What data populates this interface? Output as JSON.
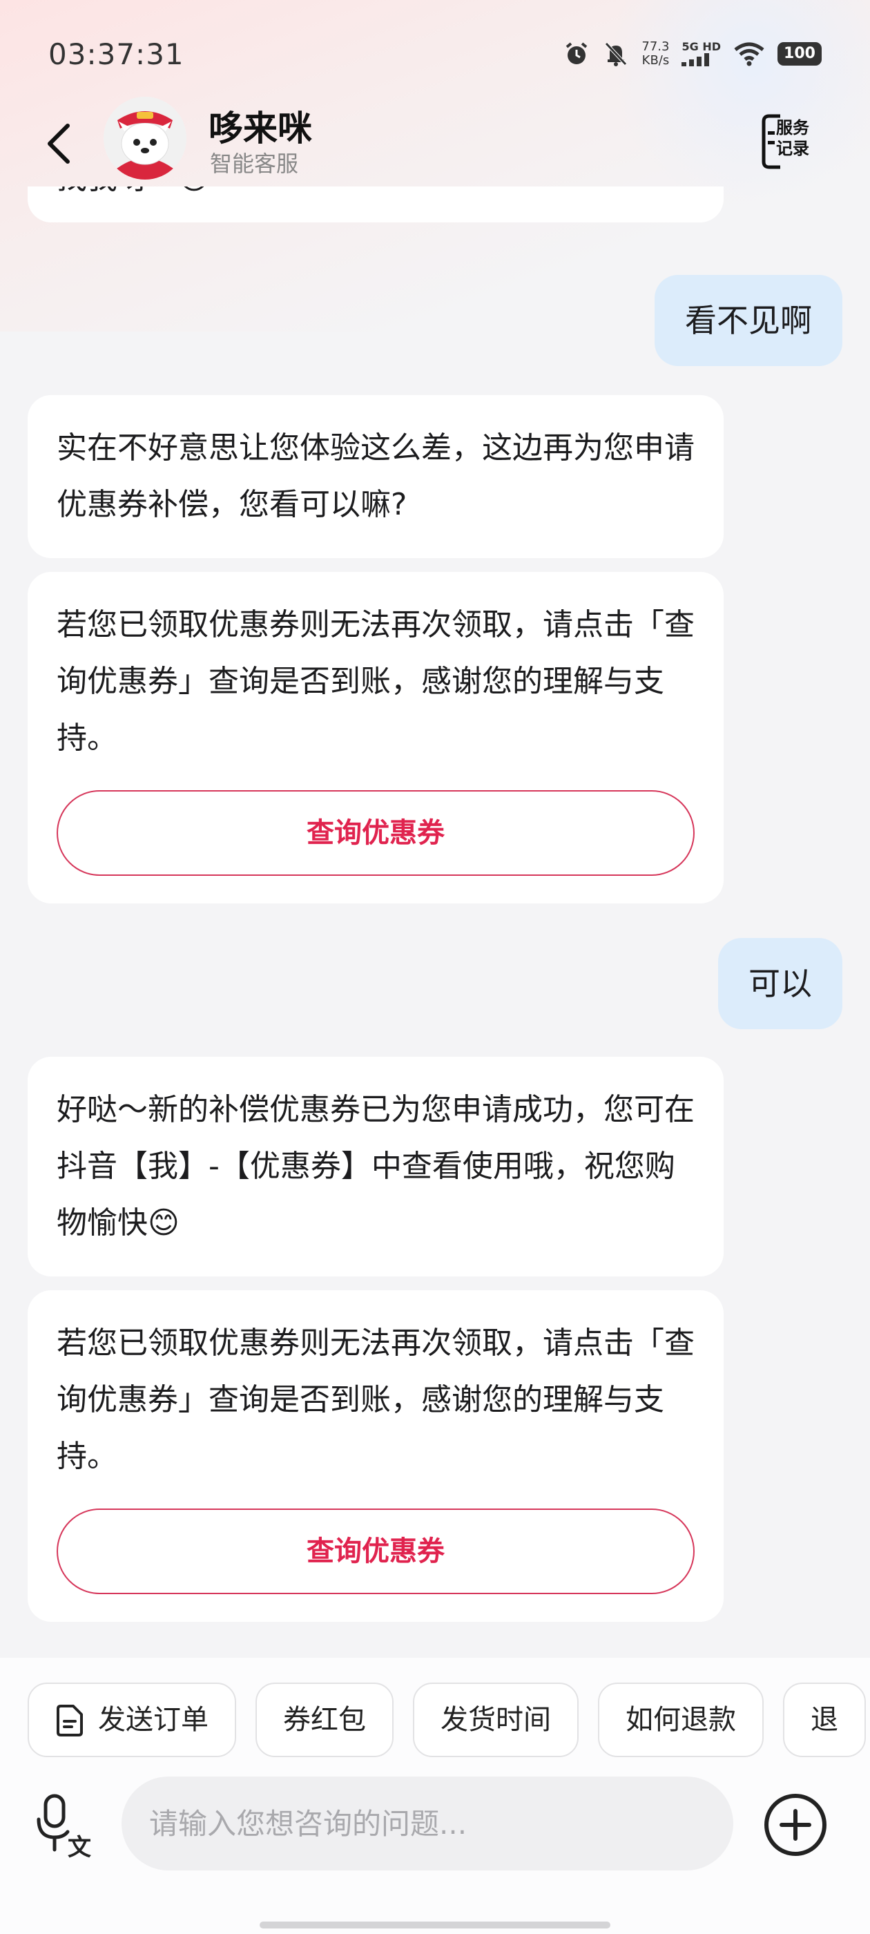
{
  "status_bar": {
    "time": "03:37:31",
    "net_speed_value": "77.3",
    "net_speed_unit": "KB/s",
    "signal_label": "5G HD",
    "battery": "100"
  },
  "header": {
    "name": "哆来咪",
    "subtitle": "智能客服",
    "record_line1": "服务",
    "record_line2": "记录"
  },
  "messages": [
    {
      "side": "left",
      "text": "找我呀～😊"
    },
    {
      "side": "right",
      "text": "看不见啊"
    },
    {
      "side": "left",
      "text": "实在不好意思让您体验这么差，这边再为您申请优惠券补偿，您看可以嘛?"
    },
    {
      "side": "left",
      "text": "若您已领取优惠券则无法再次领取，请点击「查询优惠券」查询是否到账，感谢您的理解与支持。",
      "button": "查询优惠券"
    },
    {
      "side": "right",
      "text": "可以"
    },
    {
      "side": "left",
      "text": "好哒～新的补偿优惠券已为您申请成功，您可在抖音【我】-【优惠券】中查看使用哦，祝您购物愉快😊"
    },
    {
      "side": "left",
      "text": "若您已领取优惠券则无法再次领取，请点击「查询优惠券」查询是否到账，感谢您的理解与支持。",
      "button": "查询优惠券"
    }
  ],
  "quick_replies": [
    "发送订单",
    "券红包",
    "发货时间",
    "如何退款",
    "退"
  ],
  "input": {
    "placeholder": "请输入您想咨询的问题...",
    "value": ""
  },
  "colors": {
    "accent": "#e0234e",
    "user_bubble": "#dcecfb",
    "bot_bubble": "#ffffff"
  },
  "icons": [
    "back-arrow-icon",
    "service-record-icon",
    "document-icon",
    "voice-to-text-icon",
    "plus-icon",
    "alarm-icon",
    "mute-icon",
    "signal-icon",
    "wifi-icon",
    "battery-icon"
  ]
}
